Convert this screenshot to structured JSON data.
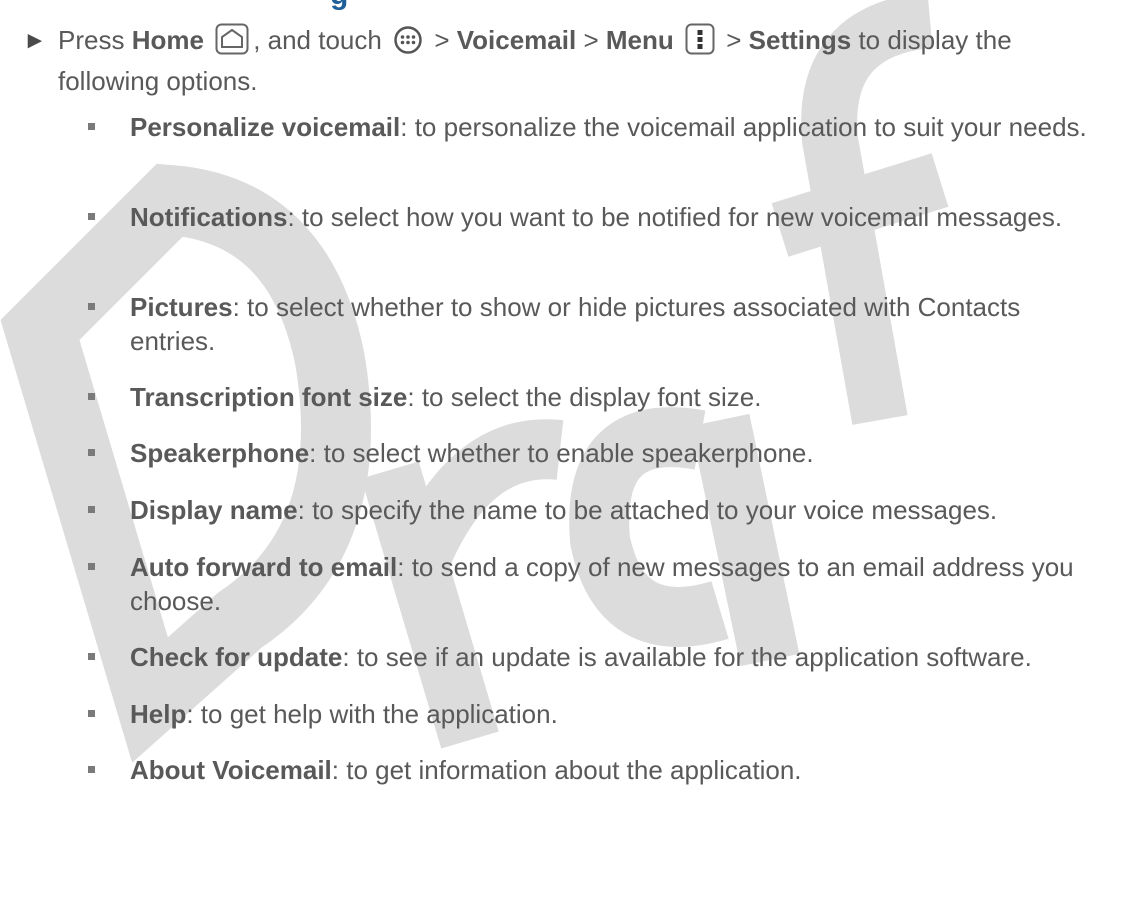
{
  "heading_partial": "g",
  "step": {
    "press": "Press",
    "home_label": "Home",
    "and_touch": ", and touch",
    "sep1": ">",
    "voicemail_label": "Voicemail",
    "sep2": ">",
    "menu_label": "Menu",
    "sep3": ">",
    "settings_label": "Settings",
    "tail": "to display the following options."
  },
  "options": [
    {
      "name": "Personalize voicemail",
      "desc": ": to personalize the voicemail application to suit your needs."
    },
    {
      "name": "Notifications",
      "desc": ": to select how you want to be notified for new voicemail messages."
    },
    {
      "name": "Pictures",
      "desc": ": to select whether to show or hide pictures associated with Contacts entries."
    },
    {
      "name": "Transcription font size",
      "desc": ": to select the display font size."
    },
    {
      "name": "Speakerphone",
      "desc": ": to select whether to enable speakerphone."
    },
    {
      "name": "Display name",
      "desc": ": to specify the name to be attached to your voice messages."
    },
    {
      "name": "Auto forward to email",
      "desc": ": to send a copy of new messages to an email address you choose."
    },
    {
      "name": "Check for update",
      "desc": ": to see if an update is available for the application software."
    },
    {
      "name": "Help",
      "desc": ": to get help with the application."
    },
    {
      "name": "About Voicemail",
      "desc": ": to get information about the application."
    }
  ],
  "watermark_text": "Draft",
  "colors": {
    "text": "#595959",
    "heading": "#1f5f9a",
    "watermark": "#d9d9d9"
  }
}
